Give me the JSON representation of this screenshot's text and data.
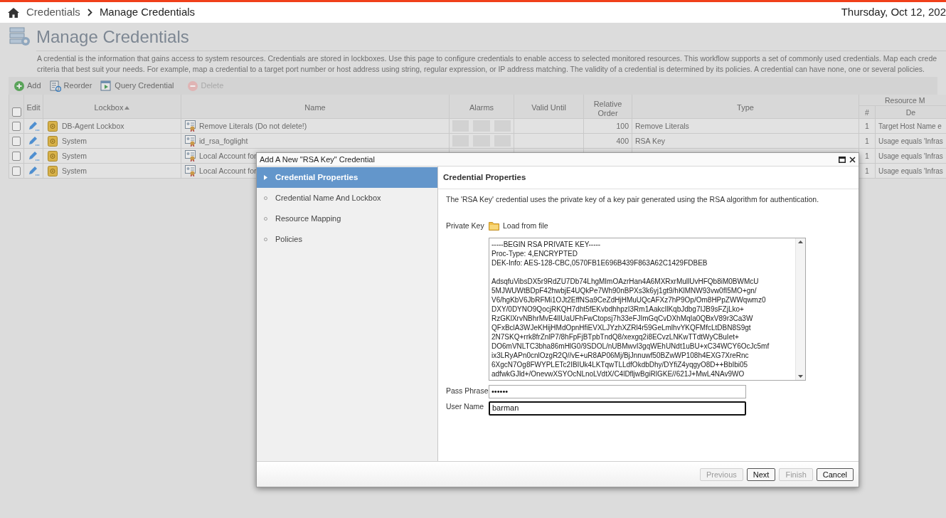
{
  "top_bar": {
    "breadcrumb": [
      {
        "label": "Credentials"
      },
      {
        "label": "Manage Credentials"
      }
    ],
    "date": "Thursday, Oct 12, 202"
  },
  "page": {
    "title": "Manage Credentials",
    "description_lines": [
      "A credential is the information that gains access to system resources. Credentials are stored in lockboxes. Use this page to configure credentials to enable access to selected monitored resources. This workflow supports a set of commonly used credentials. Map each crede",
      "criteria that best suit your needs. For example, map a credential to a target port number or host address using string, regular expression, or IP address matching. The validity of a credential is determined by its policies. A credential can have none, one or several policies."
    ]
  },
  "toolbar": [
    {
      "kind": "add",
      "label": "Add",
      "disabled": false
    },
    {
      "kind": "reorder",
      "label": "Reorder",
      "disabled": false
    },
    {
      "kind": "query",
      "label": "Query Credential",
      "disabled": false
    },
    {
      "kind": "delete",
      "label": "Delete",
      "disabled": true
    }
  ],
  "table": {
    "header_checkbox": {
      "checked": false
    },
    "columns": [
      {
        "label": "Edit"
      },
      {
        "label": "Lockbox",
        "sorted_ascending": true
      },
      {
        "label": "Name"
      },
      {
        "label": "Alarms"
      },
      {
        "label": "Valid Until"
      },
      {
        "label": "Relative Order"
      },
      {
        "label": "Type"
      }
    ],
    "group_column": {
      "label": "Resource M",
      "sub_columns": [
        "#",
        "De"
      ]
    },
    "rows": [
      {
        "checked": false,
        "lockbox": "DB-Agent Lockbox",
        "name": "Remove Literals (Do not delete!)",
        "alarm_tiles": true,
        "order": "100",
        "type": "Remove Literals",
        "mapping_count": "1",
        "mapping": "Target Host Name e"
      },
      {
        "checked": false,
        "lockbox": "System",
        "name": "id_rsa_foglight",
        "alarm_tiles": true,
        "order": "400",
        "type": "RSA Key",
        "mapping_count": "1",
        "mapping": "Usage equals 'Infras"
      },
      {
        "checked": false,
        "lockbox": "System",
        "name": "Local Account for",
        "mapping_count": "1",
        "mapping": "Usage equals 'Infras"
      },
      {
        "checked": false,
        "lockbox": "System",
        "name": "Local Account for",
        "mapping_count": "1",
        "mapping": "Usage equals 'Infras"
      }
    ]
  },
  "dialog": {
    "title": "Add A New \"RSA Key\" Credential",
    "steps": [
      {
        "label": "Credential Properties",
        "selected": true
      },
      {
        "label": "Credential Name And Lockbox",
        "selected": false
      },
      {
        "label": "Resource Mapping",
        "selected": false
      },
      {
        "label": "Policies",
        "selected": false
      }
    ],
    "heading": "Credential Properties",
    "intro": "The 'RSA Key' credential uses the private key of a key pair generated using the RSA algorithm for authentication.",
    "private_key": {
      "label": "Private Key",
      "load_link": "Load from file",
      "value": "-----BEGIN RSA PRIVATE KEY-----\nProc-Type: 4,ENCRYPTED\nDEK-Info: AES-128-CBC,0570FB1E696B439F863A62C1429FDBEB\n\nAdsqfuVibsDX5r9RdZU7Db74LhgMImOAzrHan4A6MXRxrMullUvHFQb8iM0BWMcU\n5MJWUWtBDpF42hwbjE4UQkPe7Wh90nBPXs3k6yj1gt9/hKlMNW93vw0fI5MO+gn/\nV6/hgKbV6JbRFMi1OJt2EffNSa9CeZdHjHMuUQcAFXz7hP9Op/Om8HPpZWWqwmz0\nDXY/0DYNO9QocjRKQH7dht5fEKvbdhhpzI3Rm1AakcIlKqbJdbg7IJB9sFZjLko+\nRzGKlXrvNBhrMvE4lIUaUFhFwCtopsj7h33eFJImGqCvDXhMqIa0QBxV89r3Ca3W\nQFxBclA3WJeKHijHMdOpnHfiEVXLJYzhXZRl4r59GeLmlhvYKQFMfcLtDBN8S9gt\n2N7SKQ+rrk8frZnlP7/8hFpFjBTpbTndQ8/xexgq2i8ECvzLNKwTTdtWyCBuIet+\nDO6mVNLTC3bha86mHlG0/9SDOL/nUBMwvI3gqWEhUNdt1uBU+xC34WCY6OcJc5mf\nix3LRyAPn0cnlOzgR2Q//vE+uR8AP06Mj/BjJnnuwf50BZwWP108h4EXG7XreRnc\n6XgcN7Og8FWYPLETc2IBIUk4LKTqwTLLdfOkdbDhy/DYfiZ4yqgyO8D++BbIbi05\nadfwkGJld+/OnevwXSYOcNLnoLVdtX/C4lDfljwBgiRlGKE//621J+MwL4NAv9WO"
    },
    "pass_phrase": {
      "label": "Pass Phrase",
      "value": "••••••"
    },
    "user_name": {
      "label": "User Name",
      "value": "barman",
      "focused": true
    },
    "buttons": [
      {
        "label": "Previous",
        "disabled": true
      },
      {
        "label": "Next",
        "disabled": false
      },
      {
        "label": "Finish",
        "disabled": true
      },
      {
        "label": "Cancel",
        "disabled": false
      }
    ]
  }
}
